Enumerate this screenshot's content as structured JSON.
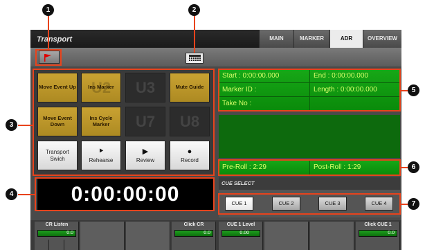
{
  "window": {
    "title": "Transport"
  },
  "tabs": [
    {
      "label": "MAIN",
      "active": false
    },
    {
      "label": "MARKER",
      "active": false
    },
    {
      "label": "ADR",
      "active": true
    },
    {
      "label": "OVERVIEW",
      "active": false
    }
  ],
  "toolbar": {
    "flag_icon": "flag-icon",
    "grid_icon": "grid-icon"
  },
  "buttons": [
    {
      "label": "Move Event Up",
      "style": "gold",
      "ghost": ""
    },
    {
      "label": "Ins Marker",
      "style": "gold",
      "ghost": "U2"
    },
    {
      "label": "U3",
      "style": "dark",
      "ghost": ""
    },
    {
      "label": "Mute Guide",
      "style": "gold",
      "ghost": ""
    },
    {
      "label": "Move Event Down",
      "style": "gold",
      "ghost": ""
    },
    {
      "label": "Ins Cycle Marker",
      "style": "gold",
      "ghost": ""
    },
    {
      "label": "U7",
      "style": "dark",
      "ghost": ""
    },
    {
      "label": "U8",
      "style": "dark",
      "ghost": ""
    },
    {
      "label": "Transport Swich",
      "style": "light",
      "glyph": ""
    },
    {
      "label": "Rehearse",
      "style": "light",
      "glyph": "⯈"
    },
    {
      "label": "Review",
      "style": "light",
      "glyph": "▶"
    },
    {
      "label": "Record",
      "style": "light",
      "glyph": "●"
    }
  ],
  "timecode": "0:00:00:00",
  "info": {
    "start": "Start : 0:00:00.000",
    "end": "End : 0:00:00.000",
    "marker_id": "Marker ID :",
    "length": "Length : 0:00:00.000",
    "take_no": "Take No :"
  },
  "roll": {
    "pre": "Pre-Roll : 2:29",
    "post": "Post-Roll : 1:29"
  },
  "cue_select": {
    "title": "CUE SELECT",
    "items": [
      {
        "label": "CUE 1",
        "active": true
      },
      {
        "label": "CUE 2",
        "active": false
      },
      {
        "label": "CUE 3",
        "active": false
      },
      {
        "label": "CUE 4",
        "active": false
      }
    ]
  },
  "channels": [
    {
      "label": "CR Listen",
      "value": "0.0"
    },
    {
      "label": "",
      "value": ""
    },
    {
      "label": "",
      "value": ""
    },
    {
      "label": "Click CR",
      "value": "0.0"
    },
    {
      "label": "CUE 1 Level",
      "value": "0.00"
    },
    {
      "label": "",
      "value": ""
    },
    {
      "label": "",
      "value": ""
    },
    {
      "label": "Click CUE 1",
      "value": "0.0"
    }
  ],
  "callouts": [
    "1",
    "2",
    "3",
    "4",
    "5",
    "6",
    "7"
  ],
  "colors": {
    "callout": "#e8431c",
    "gold": "#c9a232",
    "green": "#0f9a0f",
    "text_green": "#d8ff6a"
  }
}
